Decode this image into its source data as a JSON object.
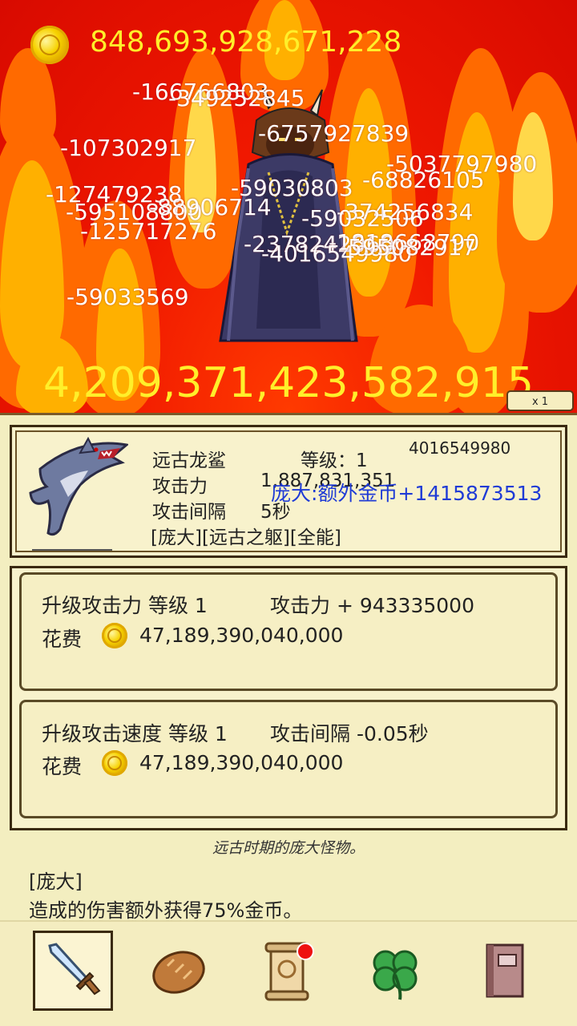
{
  "top": {
    "gold_total": "848,693,928,671,228",
    "gold_icon": "gold-coin-icon",
    "boss_hp": "4,209,371,423,582,915",
    "speed_label": "x 1"
  },
  "damage_numbers": [
    "-166766803",
    "-349252845",
    "-6757927839",
    "-107302917",
    "-5037797980",
    "-68826105",
    "-127479238",
    "-59030803",
    "-595108800",
    "-88906714",
    "-374256834",
    "-59032506",
    "-125717276",
    "-2378242060",
    "-1818668790",
    "-4016549980",
    "-595082917",
    "-59033569"
  ],
  "hero": {
    "name": "远古龙鲨",
    "level_label": "等级：1",
    "last_damage": "4016549980",
    "attack_label": "攻击力",
    "attack_value": "1,887,831,351",
    "interval_label": "攻击间隔",
    "interval_value": "5秒",
    "traits": "[庞大][远古之躯][全能]",
    "bonus_popup": "庞大:额外金币+1415873513",
    "icon": "shark-icon"
  },
  "upgrades": [
    {
      "title": "升级攻击力 等级 1",
      "effect": "攻击力 + 943335000",
      "cost_label": "花费",
      "cost": "47,189,390,040,000"
    },
    {
      "title": "升级攻击速度 等级 1",
      "effect": "攻击间隔 -0.05秒",
      "cost_label": "花费",
      "cost": "47,189,390,040,000"
    }
  ],
  "description": "远古时期的庞大怪物。",
  "trait_name": "[庞大]",
  "trait_desc": "造成的伤害额外获得75%金币。",
  "nav": [
    {
      "name": "sword-icon",
      "active": true
    },
    {
      "name": "bread-icon",
      "active": false
    },
    {
      "name": "scroll-icon",
      "active": false,
      "badge": true
    },
    {
      "name": "clover-icon",
      "active": false
    },
    {
      "name": "book-icon",
      "active": false
    }
  ],
  "colors": {
    "gold_text": "#ffef2a",
    "bonus_text": "#1f3bd6",
    "panel_bg": "#f3eec0",
    "badge": "#ee1111"
  }
}
